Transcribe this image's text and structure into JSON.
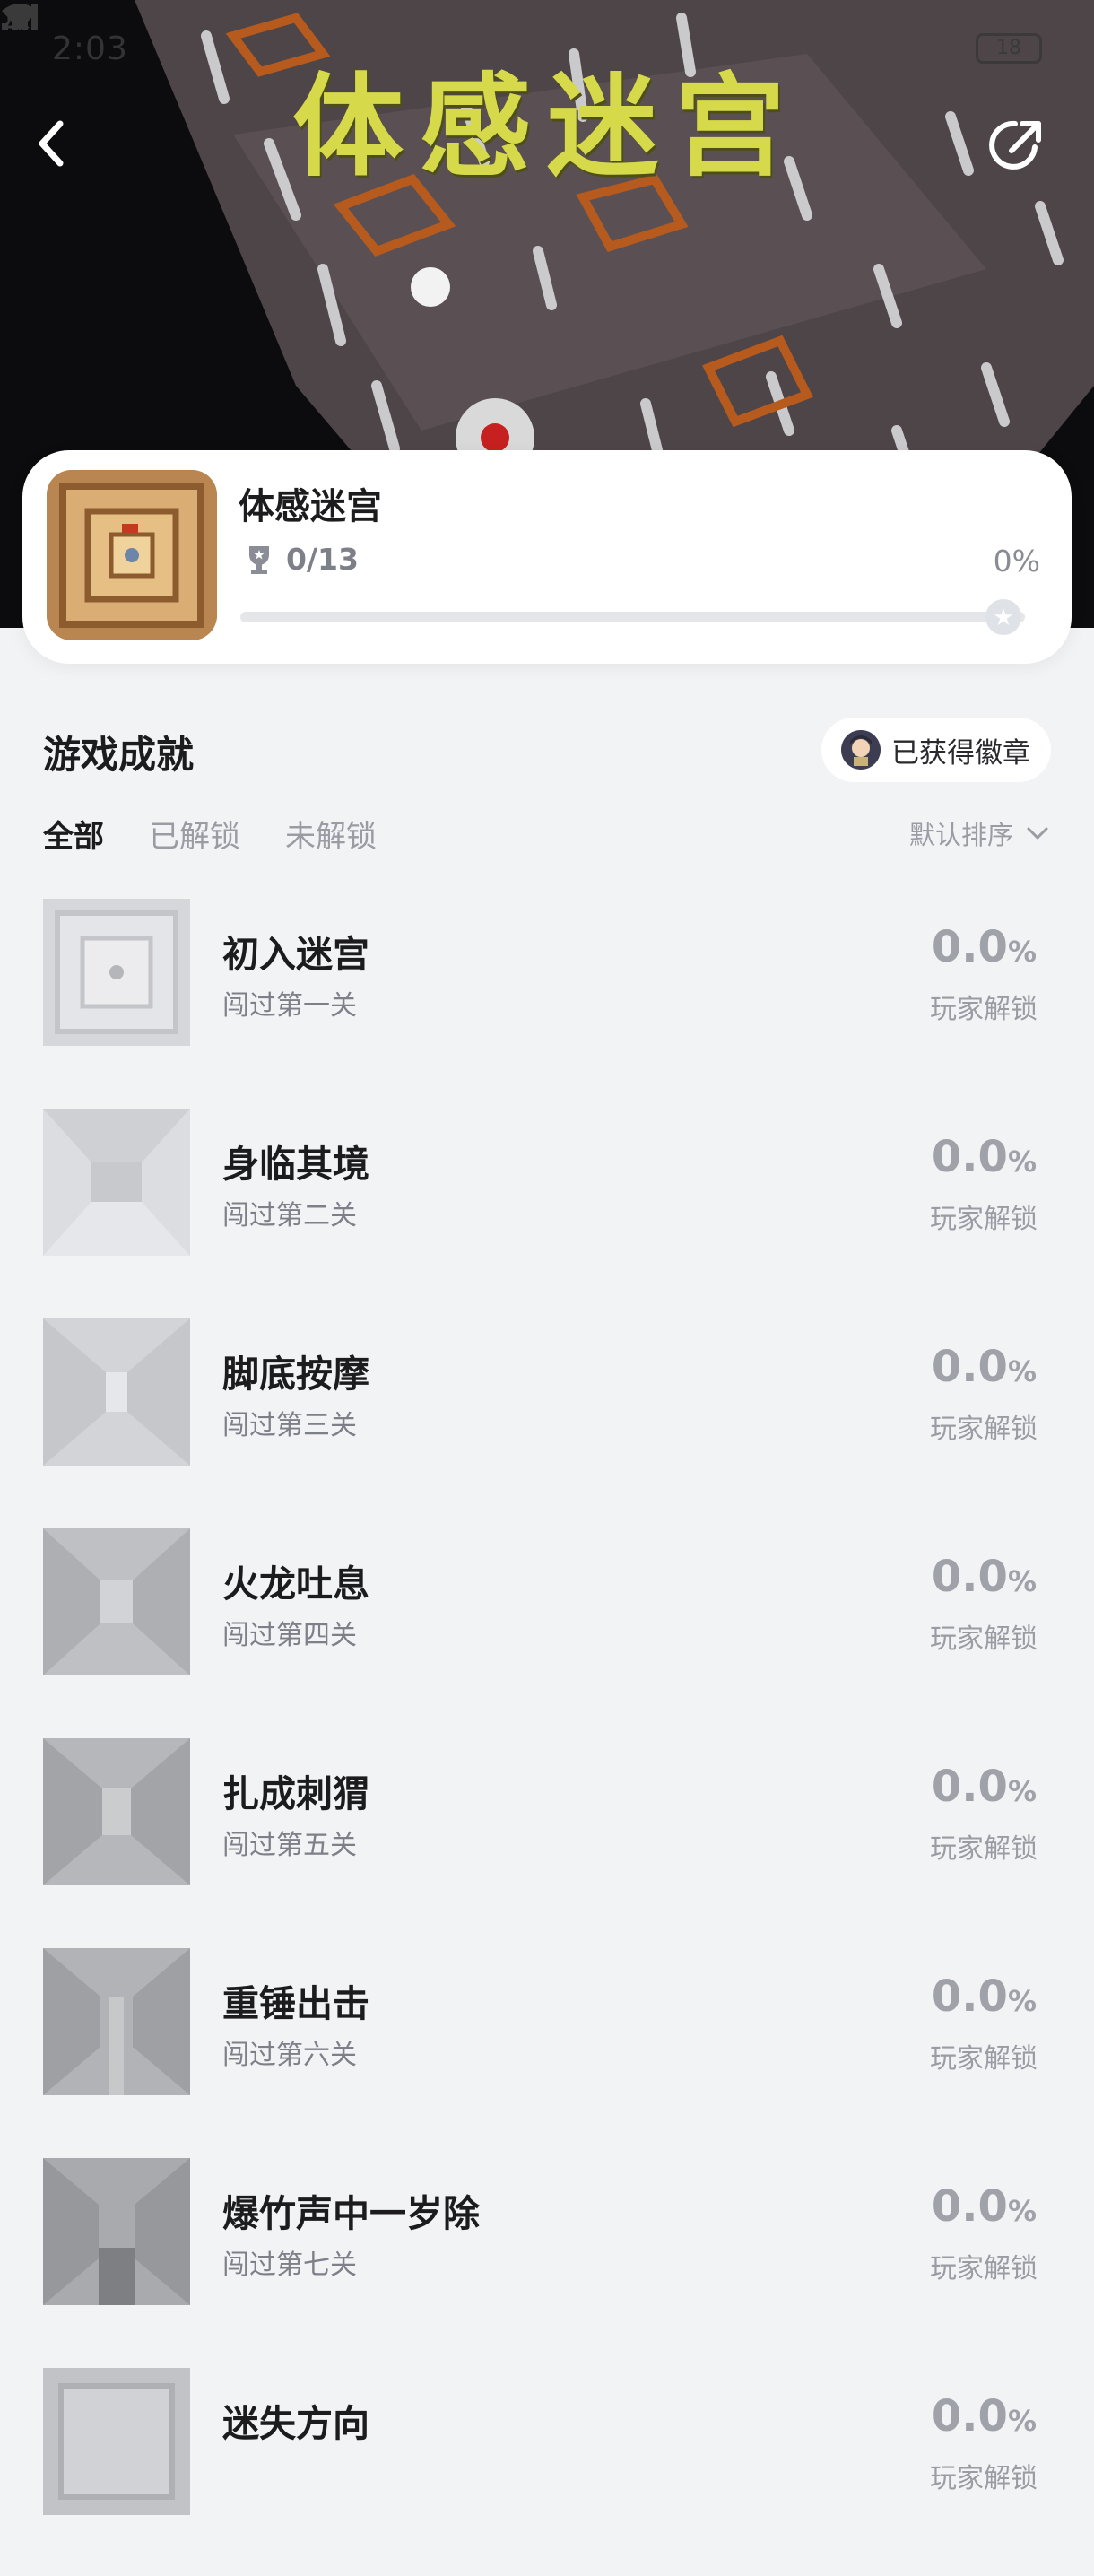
{
  "status_bar": {
    "time": "2:03",
    "battery": "18"
  },
  "hero": {
    "title": "体感迷宫"
  },
  "game": {
    "name": "体感迷宫",
    "trophies": "0/13",
    "progress_text": "0%",
    "progress": 0
  },
  "achievements": {
    "title": "游戏成就",
    "badge_button": "已获得徽章",
    "tabs": [
      "全部",
      "已解锁",
      "未解锁"
    ],
    "active_tab": 0,
    "sort_label": "默认排序",
    "unlock_label": "玩家解锁",
    "items": [
      {
        "name": "初入迷宫",
        "desc": "闯过第一关",
        "rate": "0.0",
        "unit": "%"
      },
      {
        "name": "身临其境",
        "desc": "闯过第二关",
        "rate": "0.0",
        "unit": "%"
      },
      {
        "name": "脚底按摩",
        "desc": "闯过第三关",
        "rate": "0.0",
        "unit": "%"
      },
      {
        "name": "火龙吐息",
        "desc": "闯过第四关",
        "rate": "0.0",
        "unit": "%"
      },
      {
        "name": "扎成刺猬",
        "desc": "闯过第五关",
        "rate": "0.0",
        "unit": "%"
      },
      {
        "name": "重锤出击",
        "desc": "闯过第六关",
        "rate": "0.0",
        "unit": "%"
      },
      {
        "name": "爆竹声中一岁除",
        "desc": "闯过第七关",
        "rate": "0.0",
        "unit": "%"
      },
      {
        "name": "迷失方向",
        "desc": "",
        "rate": "0.0",
        "unit": "%"
      }
    ]
  }
}
